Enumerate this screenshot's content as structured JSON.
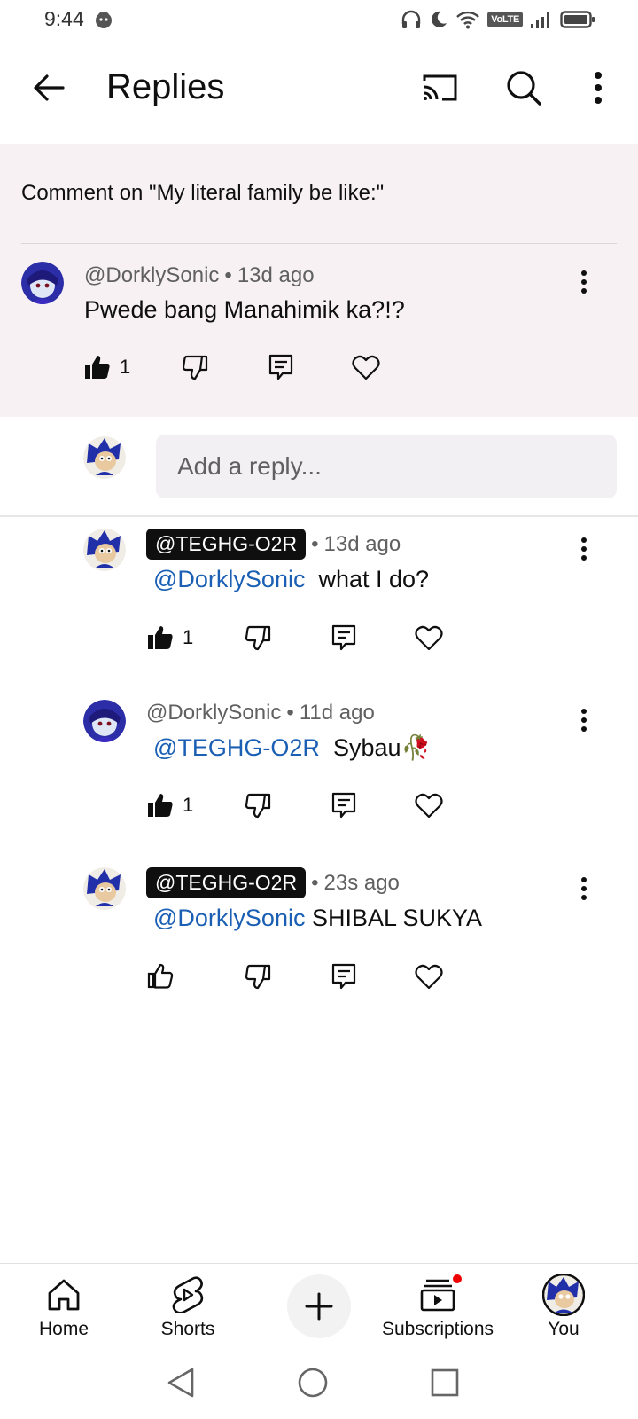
{
  "status_bar": {
    "time": "9:44",
    "volte": "VoLTE",
    "icons": [
      "headphones-icon",
      "moon-icon",
      "wifi-icon",
      "signal-icon",
      "battery-icon"
    ]
  },
  "app_bar": {
    "title": "Replies",
    "icons": [
      "back-arrow-icon",
      "cast-icon",
      "search-icon",
      "more-vert-icon"
    ]
  },
  "parent": {
    "comment_on": "Comment on \"My literal family be like:\"",
    "author": "@DorklySonic",
    "age": "13d ago",
    "text": "Pwede bang Manahimik ka?!?",
    "likes": "1"
  },
  "reply_input": {
    "placeholder": "Add a reply..."
  },
  "replies": [
    {
      "author": "@TEGHG-O2R",
      "is_creator_chip": true,
      "age": "13d ago",
      "mention": "@DorklySonic",
      "text": "what I do?",
      "likes": "1",
      "liked": true
    },
    {
      "author": "@DorklySonic",
      "is_creator_chip": false,
      "age": "11d ago",
      "mention": "@TEGHG-O2R",
      "text": "Sybau🥀",
      "likes": "1",
      "liked": true
    },
    {
      "author": "@TEGHG-O2R",
      "is_creator_chip": true,
      "age": "23s ago",
      "mention": "@DorklySonic",
      "text": "SHIBAL SUKYA",
      "likes": "",
      "liked": false
    }
  ],
  "bottom_nav": {
    "home": "Home",
    "shorts": "Shorts",
    "subscriptions": "Subscriptions",
    "you": "You"
  },
  "colors": {
    "mention": "#1a5fb4",
    "parent_bg": "#f7f1f3",
    "notification": "#ee0000"
  }
}
